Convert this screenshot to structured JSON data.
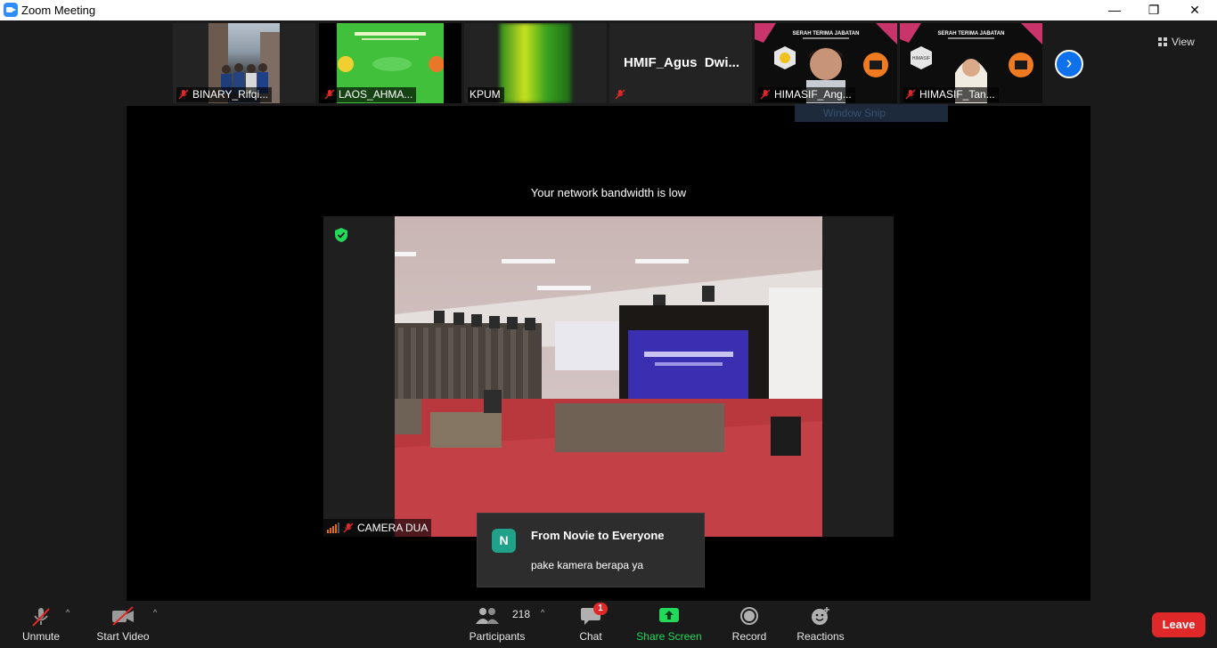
{
  "window": {
    "title": "Zoom Meeting",
    "minimize_glyph": "—",
    "restore_glyph": "❐",
    "close_glyph": "✕"
  },
  "gallery": {
    "participants": [
      {
        "name": "BINARY_Rifqi...",
        "muted": true
      },
      {
        "name": "LAOS_AHMA...",
        "muted": true
      },
      {
        "name": "KPUM",
        "muted": false
      },
      {
        "name": "HMIF_Agus_Dwi...",
        "display_title": "HMIF_Agus  Dwi...",
        "muted": true
      },
      {
        "name": "HIMASIF_Ang...",
        "muted": true
      },
      {
        "name": "HIMASIF_Tan...",
        "muted": true
      }
    ],
    "next_icon": "chevron-right-icon",
    "view_label": "View",
    "snip_ghost_text": "Window Snip",
    "banner_title": "SERAH TERIMA JABATAN",
    "banner_seal": "HIMASIF"
  },
  "main_video": {
    "notice": "Your network bandwidth is low",
    "participant_name": "CAMERA DUA"
  },
  "chat_toast": {
    "avatar_letter": "N",
    "from": "From Novie to Everyone",
    "message": "pake kamera berapa ya"
  },
  "toolbar": {
    "unmute": "Unmute",
    "start_video": "Start Video",
    "participants_count": "218",
    "participants": "Participants",
    "chat": "Chat",
    "chat_badge": "1",
    "share_screen": "Share Screen",
    "record": "Record",
    "reactions": "Reactions",
    "leave": "Leave"
  },
  "colors": {
    "accent_blue": "#0e71eb",
    "share_green": "#23d959",
    "leave_red": "#e02828",
    "muted_red": "#e02828"
  }
}
